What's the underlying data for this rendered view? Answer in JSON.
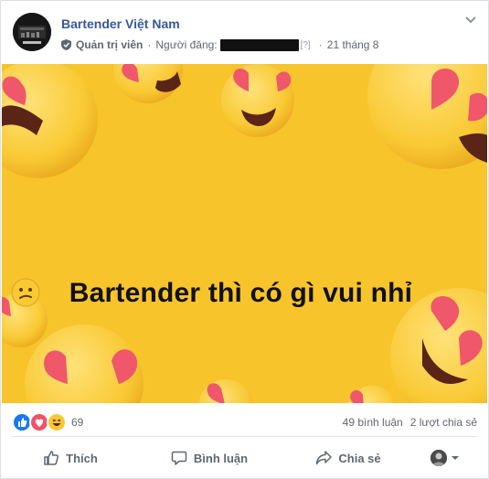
{
  "post": {
    "page_name": "Bartender Việt Nam",
    "role": "Quản trị viên",
    "poster_label": "Người đăng:",
    "help_mark": "[?]",
    "date": "21 tháng 8"
  },
  "banner": {
    "text": "Bartender thì có gì vui nhỉ",
    "background": "#f7c42c"
  },
  "stats": {
    "reaction_count": "69",
    "comments": "49 bình luận",
    "shares": "2 lượt chia sẻ",
    "reaction_icons": [
      "like-icon",
      "love-icon",
      "haha-icon"
    ]
  },
  "actions": {
    "like": "Thích",
    "comment": "Bình luận",
    "share": "Chia sẻ"
  },
  "colors": {
    "link": "#365899",
    "muted": "#616770",
    "like_blue": "#1877f2",
    "love_red": "#f25268"
  }
}
